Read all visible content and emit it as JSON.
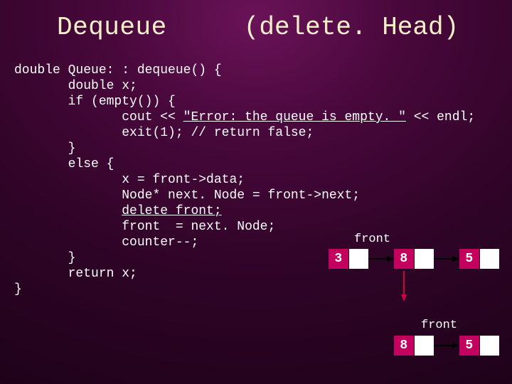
{
  "title": {
    "name": "Dequeue",
    "paren": "(delete. Head)"
  },
  "code": {
    "l1a": "double",
    "l1b": " Queue: : dequeue() {",
    "l2": "double",
    "l2b": " x;",
    "l3": "if (empty()) {",
    "l4a": "cout << ",
    "l4s": "\"Error: the queue is empty. \"",
    "l4b": " << endl;",
    "l5": "exit(1); // return false;",
    "l6": "}",
    "l7": "else {",
    "l8": "x = front->data;",
    "l9": "Node* next. Node = front->next;",
    "l10": "delete front;",
    "l11": "front  = next. Node;",
    "l12": "counter--;",
    "l13": "}",
    "l14": "return x;",
    "l15": "}"
  },
  "labels": {
    "front1": "front",
    "front2": "front"
  },
  "diagram": {
    "nodes1": [
      {
        "value": "3"
      },
      {
        "value": "8"
      },
      {
        "value": "5"
      }
    ],
    "nodes2": [
      {
        "value": "8"
      },
      {
        "value": "5"
      }
    ]
  }
}
